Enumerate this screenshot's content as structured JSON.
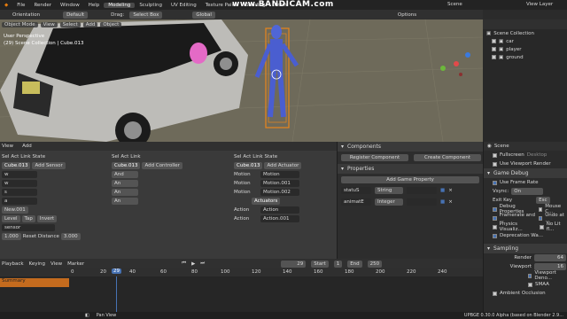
{
  "menubar": {
    "items": [
      "File",
      "Render",
      "Window",
      "Help"
    ],
    "workspaces": [
      "Modeling",
      "Sculpting",
      "UV Editing",
      "Texture Paint",
      "Shading",
      "Anim"
    ],
    "active_ws": "Modeling",
    "watermark": "www.BANDICAM.com",
    "scene": "Scene",
    "viewlayer": "View Layer"
  },
  "toolbar": {
    "orientation_label": "Orientation",
    "orientation": "Default",
    "drag_label": "Drag:",
    "drag": "Select Box",
    "transform": "Global",
    "options": "Options"
  },
  "viewport": {
    "menus": [
      "Object Mode",
      "View",
      "Select",
      "Add",
      "Object"
    ],
    "persp": "User Perspective",
    "collection": "(29) Scene Collection | Cube.013"
  },
  "outliner": {
    "title": "Scene Collection",
    "items": [
      "car",
      "player",
      "ground"
    ]
  },
  "logic": {
    "menus": [
      "View",
      "Add"
    ],
    "sensors": {
      "header": [
        "Sel",
        "Act",
        "Link",
        "State"
      ],
      "object": "Cube.013",
      "add": "Add Sensor",
      "rows": [
        "w",
        "w",
        "s",
        "a"
      ],
      "prop": "New.001",
      "buttons": [
        "Level",
        "Tap",
        "Invert"
      ],
      "sensor_name": "sensor",
      "freq": "1.000",
      "reset": "Reset Distance",
      "reset_val": "3.000"
    },
    "controllers": {
      "header": [
        "Sel",
        "Act",
        "Link"
      ],
      "object": "Cube.013",
      "add": "Add Controller",
      "rows": [
        "And",
        "An",
        "An",
        "An"
      ]
    },
    "actuators": {
      "header": [
        "Sel",
        "Act",
        "Link",
        "State"
      ],
      "object": "Cube.013",
      "add": "Add Actuator",
      "rows": [
        {
          "type": "Motion",
          "name": "Motion"
        },
        {
          "type": "Motion",
          "name": "Motion.001"
        },
        {
          "type": "Motion",
          "name": "Motion.002"
        },
        {
          "type": "Action",
          "name": "Action"
        },
        {
          "type": "Action",
          "name": "Action.001"
        }
      ],
      "sub": "Actuators"
    }
  },
  "game": {
    "components": "Components",
    "register": "Register Component",
    "create": "Create Component",
    "properties": "Properties",
    "add_prop": "Add Game Property",
    "props": [
      {
        "name": "statuS",
        "type": "String"
      },
      {
        "name": "animatE",
        "type": "Integer"
      }
    ]
  },
  "props_panel": {
    "scene": "Scene",
    "fullscreen": "Fullscreen",
    "desktop": "Desktop",
    "use_viewport": "Use Viewport Render",
    "game_debug": "Game Debug",
    "use_frame_rate": "Use Frame Rate",
    "vsync_label": "Vsync:",
    "vsync": "On",
    "exit_key": "Exit Key",
    "exit_val": "Esc",
    "debug": [
      "Debug Properties",
      "Framerate and ...",
      "Physics Visualiz...",
      "Deprecation Wa..."
    ],
    "debug_r": [
      "Mouse C...",
      "Undo at ...",
      "No Lit fl..."
    ],
    "sampling": "Sampling",
    "render_label": "Render",
    "render_val": "64",
    "viewport_label": "Viewport",
    "viewport_val": "16",
    "viewport_denoise": "Viewport Deno...",
    "smaa": "SMAA",
    "ambient": "Ambient Occlusion"
  },
  "timeline": {
    "menus": [
      "Playback",
      "Keying",
      "View",
      "Marker"
    ],
    "frame": "29",
    "start_label": "Start",
    "start": "1",
    "end_label": "End",
    "end": "250",
    "ticks": [
      "0",
      "20",
      "29",
      "40",
      "60",
      "80",
      "100",
      "120",
      "140",
      "160",
      "180",
      "200",
      "220",
      "240"
    ],
    "track": "Summary"
  },
  "status": {
    "pan": "Pan View",
    "version": "UPBGE 0.30.0 Alpha (based on Blender 2.9..."
  }
}
